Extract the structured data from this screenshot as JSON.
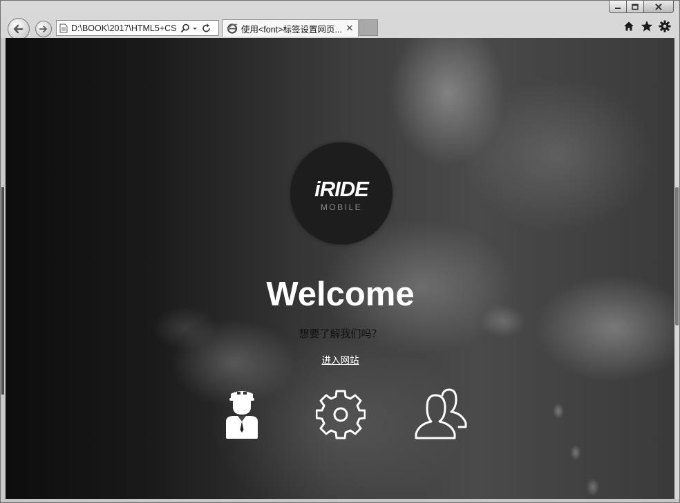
{
  "window": {
    "controls": [
      "minimize-icon",
      "maximize-icon",
      "close-icon"
    ]
  },
  "toolbar": {
    "address": "D:\\BOOK\\2017\\HTML5+CS",
    "tab_title": "使用<font>标签设置网页...",
    "tab_close": "✕",
    "tools": [
      "home-icon",
      "star-icon",
      "gear-icon"
    ]
  },
  "page": {
    "logo_main": "iRIDE",
    "logo_sub": "MOBILE",
    "welcome": "Welcome",
    "question": "想要了解我们吗？",
    "link": "进入网站",
    "icons": [
      "driver-icon",
      "settings-icon",
      "users-icon"
    ]
  },
  "colors": {
    "logo_bg": "#1d1d1d",
    "welcome": "#ffffff",
    "question": "#111111"
  }
}
